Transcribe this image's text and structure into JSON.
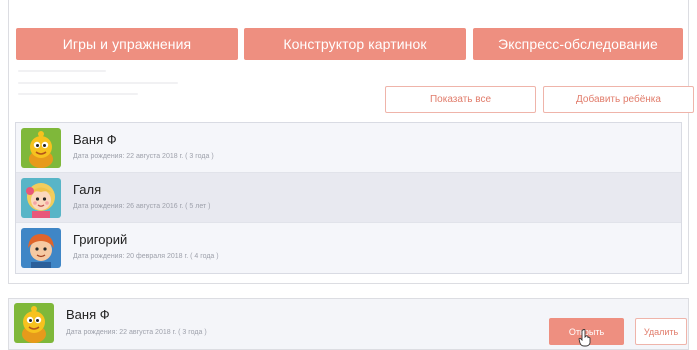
{
  "nav": {
    "games_label": "Игры и упражнения",
    "constructor_label": "Конструктор картинок",
    "express_label": "Экспресс-обследование"
  },
  "actions": {
    "show_all_label": "Показать все",
    "add_child_label": "Добавить ребёнка"
  },
  "children": [
    {
      "name": "Ваня Ф",
      "birthdate": "Дата рождения: 22 августа 2018 г. ( 3 года )",
      "avatar_icon": "yellow-creature-avatar-icon"
    },
    {
      "name": "Галя",
      "birthdate": "Дата рождения: 26 августа 2016 г. ( 5 лет )",
      "avatar_icon": "blonde-girl-avatar-icon"
    },
    {
      "name": "Григорий",
      "birthdate": "Дата рождения: 20 февраля 2018 г. ( 4 года )",
      "avatar_icon": "redhead-boy-avatar-icon"
    }
  ],
  "detail": {
    "name": "Ваня Ф",
    "birthdate": "Дата рождения: 22 августа 2018 г. ( 3 года )",
    "open_label": "Открыть",
    "delete_label": "Удалить"
  },
  "colors": {
    "accent": "#ee8f80",
    "accent_text": "#e17c6b",
    "row_bg": "#f5f6fa",
    "row_selected_bg": "#e8e9f0"
  }
}
